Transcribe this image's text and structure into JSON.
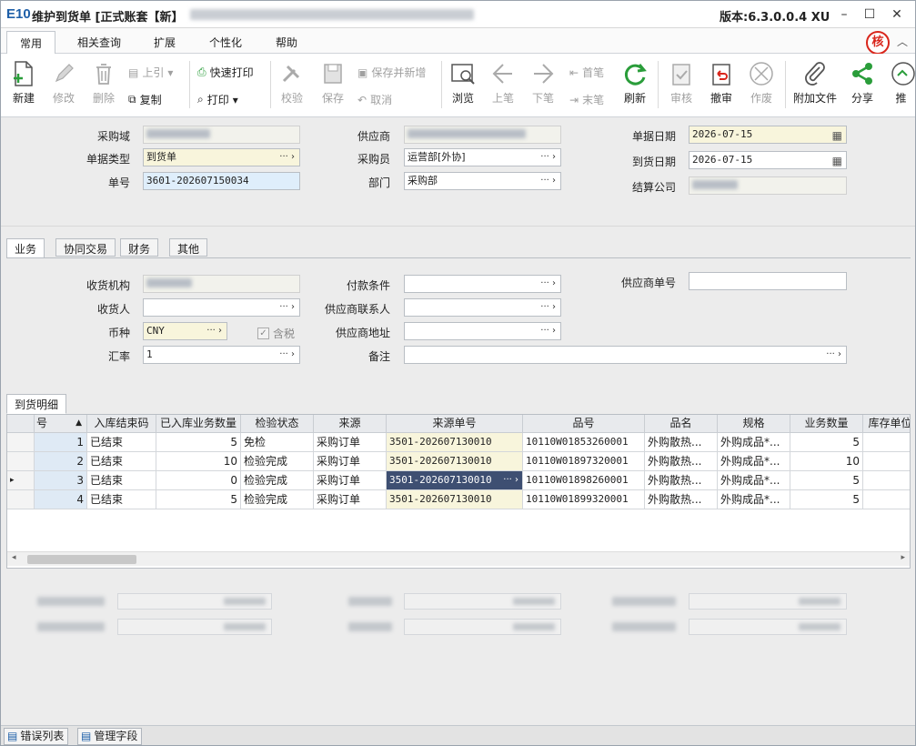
{
  "window": {
    "title": "维护到货单 [正式账套【新】",
    "version": "版本:6.3.0.0.4 XU",
    "logo": "E10"
  },
  "menus": [
    "常用",
    "相关查询",
    "扩展",
    "个性化",
    "帮助"
  ],
  "verify_badge": "核",
  "toolbar": {
    "new": "新建",
    "edit": "修改",
    "delete": "删除",
    "quote": "上引",
    "copy": "复制",
    "quick_print": "快速打印",
    "print": "打印",
    "inspect": "校验",
    "save": "保存",
    "save_new": "保存并新增",
    "cancel": "取消",
    "browse": "浏览",
    "prev": "上笔",
    "next": "下笔",
    "first": "首笔",
    "last": "末笔",
    "refresh": "刷新",
    "audit": "审核",
    "unaudit": "撤审",
    "void": "作废",
    "attach": "附加文件",
    "share": "分享",
    "push": "推"
  },
  "header": {
    "purchase_domain_label": "采购域",
    "doc_type_label": "单据类型",
    "doc_type": "到货单",
    "doc_no_label": "单号",
    "doc_no": "3601-202607150034",
    "supplier_label": "供应商",
    "buyer_label": "采购员",
    "buyer": "运营部[外协]",
    "dept_label": "部门",
    "dept": "采购部",
    "doc_date_label": "单据日期",
    "doc_date": "2026-07-15",
    "arrival_date_label": "到货日期",
    "arrival_date": "2026-07-15",
    "settle_label": "结算公司"
  },
  "tabs": [
    "业务",
    "协同交易",
    "财务",
    "其他"
  ],
  "business": {
    "receive_org_label": "收货机构",
    "receiver_label": "收货人",
    "currency_label": "币种",
    "currency": "CNY",
    "tax_label": "含税",
    "rate_label": "汇率",
    "rate": "1",
    "payment_label": "付款条件",
    "contact_label": "供应商联系人",
    "address_label": "供应商地址",
    "remark_label": "备注",
    "supplier_no_label": "供应商单号"
  },
  "detail_tab": "到货明细",
  "grid": {
    "columns": [
      "号",
      "入库结束码",
      "已入库业务数量",
      "检验状态",
      "来源",
      "来源单号",
      "品号",
      "品名",
      "规格",
      "业务数量",
      "库存单位"
    ],
    "rows": [
      [
        "1",
        "已结束",
        "5",
        "免检",
        "采购订单",
        "3501-202607130010",
        "10110W01853260001",
        "外购散热...",
        "外购成品*...",
        "5"
      ],
      [
        "2",
        "已结束",
        "10",
        "检验完成",
        "采购订单",
        "3501-202607130010",
        "10110W01897320001",
        "外购散热...",
        "外购成品*...",
        "10"
      ],
      [
        "3",
        "已结束",
        "0",
        "检验完成",
        "采购订单",
        "3501-202607130010",
        "10110W01898260001",
        "外购散热...",
        "外购成品*...",
        "5"
      ],
      [
        "4",
        "已结束",
        "5",
        "检验完成",
        "采购订单",
        "3501-202607130010",
        "10110W01899320001",
        "外购散热...",
        "外购成品*...",
        "5"
      ]
    ]
  },
  "status": {
    "errors": "错误列表",
    "fields": "管理字段"
  }
}
